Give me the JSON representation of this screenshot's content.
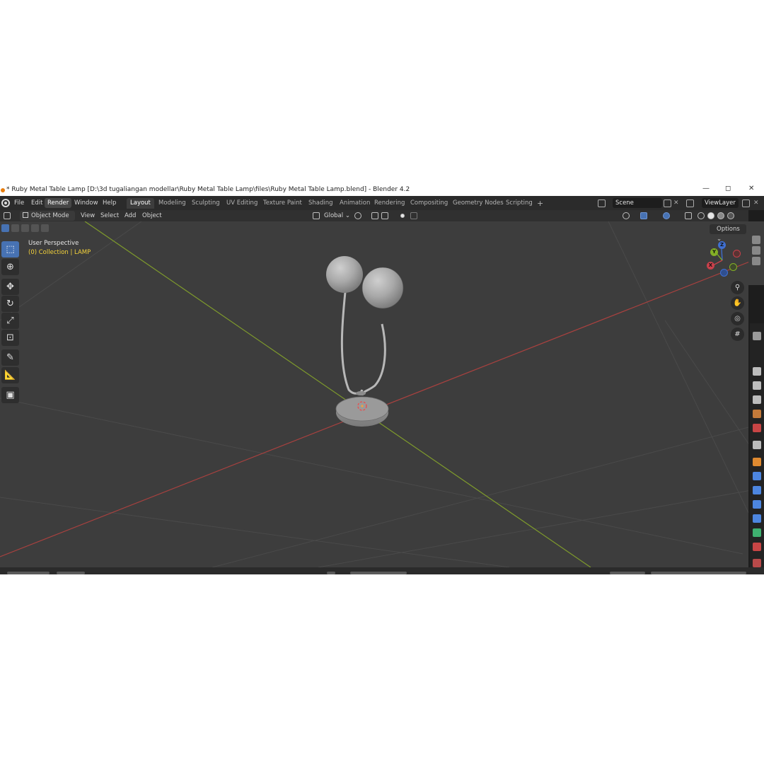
{
  "titlebar": {
    "title": "* Ruby Metal Table Lamp [D:\\3d tugaliangan modellar\\Ruby Metal Table Lamp\\files\\Ruby Metal Table Lamp.blend] - Blender 4.2",
    "minimize": "—",
    "maximize": "◻",
    "close": "✕"
  },
  "menu": {
    "file": "File",
    "edit": "Edit",
    "render": "Render",
    "window": "Window",
    "help": "Help"
  },
  "workspaces": [
    {
      "label": "Layout"
    },
    {
      "label": "Modeling"
    },
    {
      "label": "Sculpting"
    },
    {
      "label": "UV Editing"
    },
    {
      "label": "Texture Paint"
    },
    {
      "label": "Shading"
    },
    {
      "label": "Animation"
    },
    {
      "label": "Rendering"
    },
    {
      "label": "Compositing"
    },
    {
      "label": "Geometry Nodes"
    },
    {
      "label": "Scripting"
    }
  ],
  "add_workspace": "+",
  "scene": {
    "value": "Scene"
  },
  "view_layer": {
    "value": "ViewLayer"
  },
  "viewport_header": {
    "mode": "Object Mode",
    "view": "View",
    "select": "Select",
    "add": "Add",
    "object": "Object",
    "transform_orientation": "Global",
    "options": "Options"
  },
  "viewport": {
    "perspective_label": "User Perspective",
    "collection_label": "(0) Collection | LAMP"
  },
  "gizmo": {
    "x": "X",
    "y": "Y",
    "z": "Z"
  },
  "colors": {
    "accent": "#4772b3",
    "x_axis": "#c8414b",
    "y_axis": "#84b026",
    "z_axis": "#3f6fd1",
    "collection_text": "#f5d33b"
  }
}
